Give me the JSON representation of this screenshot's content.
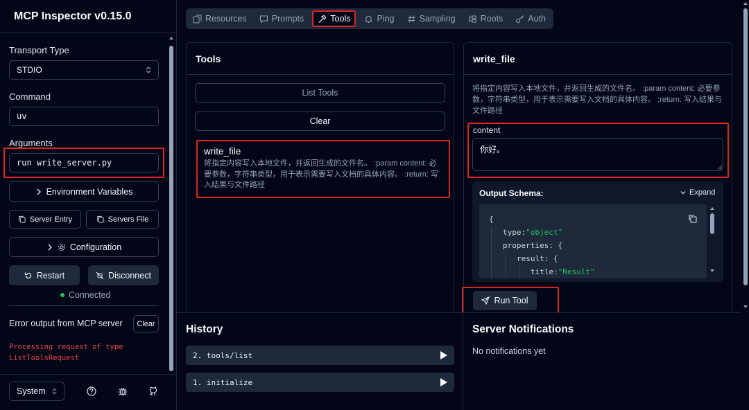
{
  "app": {
    "title": "MCP Inspector v0.15.0"
  },
  "sidebar": {
    "transport_label": "Transport Type",
    "transport_value": "STDIO",
    "command_label": "Command",
    "command_value": "uv",
    "arguments_label": "Arguments",
    "arguments_value": "run write_server.py",
    "env_vars_label": "Environment Variables",
    "server_entry_label": "Server Entry",
    "servers_file_label": "Servers File",
    "configuration_label": "Configuration",
    "restart_label": "Restart",
    "disconnect_label": "Disconnect",
    "status_text": "Connected",
    "status_color": "#22c55e",
    "error_title": "Error output from MCP server",
    "clear_label": "Clear",
    "error_lines": [
      "Processing request of type",
      "ListToolsRequest"
    ],
    "theme_value": "System",
    "footer_icons": [
      "help-icon",
      "bug-icon",
      "github-icon"
    ]
  },
  "tabs": [
    {
      "label": "Resources",
      "icon": "resources-icon"
    },
    {
      "label": "Prompts",
      "icon": "prompts-icon"
    },
    {
      "label": "Tools",
      "icon": "hammer-icon",
      "active": true
    },
    {
      "label": "Ping",
      "icon": "bell-icon"
    },
    {
      "label": "Sampling",
      "icon": "hash-icon"
    },
    {
      "label": "Roots",
      "icon": "tree-icon"
    },
    {
      "label": "Auth",
      "icon": "key-icon"
    }
  ],
  "tools_panel": {
    "title": "Tools",
    "list_tools_label": "List Tools",
    "clear_label": "Clear",
    "tool": {
      "name": "write_file",
      "description": "将指定内容写入本地文件，并返回生成的文件名。 :param content: 必要参数，字符串类型，用于表示需要写入文档的具体内容。 :return: 写入结果与文件路径"
    }
  },
  "detail_panel": {
    "title": "write_file",
    "description": "将指定内容写入本地文件，并返回生成的文件名。 :param content: 必要参数，字符串类型，用于表示需要写入文档的具体内容。 :return: 写入结果与文件路径",
    "content_label": "content",
    "content_value": "你好。",
    "output_schema_label": "Output Schema:",
    "expand_label": "Expand",
    "schema": {
      "open": "{",
      "type_key": "type:",
      "type_val": "\"object\"",
      "props_key": "properties:",
      "props_open": "{",
      "result_key": "result:",
      "result_open": "{",
      "title_key": "title:",
      "title_val": "\"Result\""
    },
    "run_tool_label": "Run Tool"
  },
  "history": {
    "title": "History",
    "items": [
      "2. tools/list",
      "1. initialize"
    ]
  },
  "notifications": {
    "title": "Server Notifications",
    "empty_text": "No notifications yet"
  }
}
